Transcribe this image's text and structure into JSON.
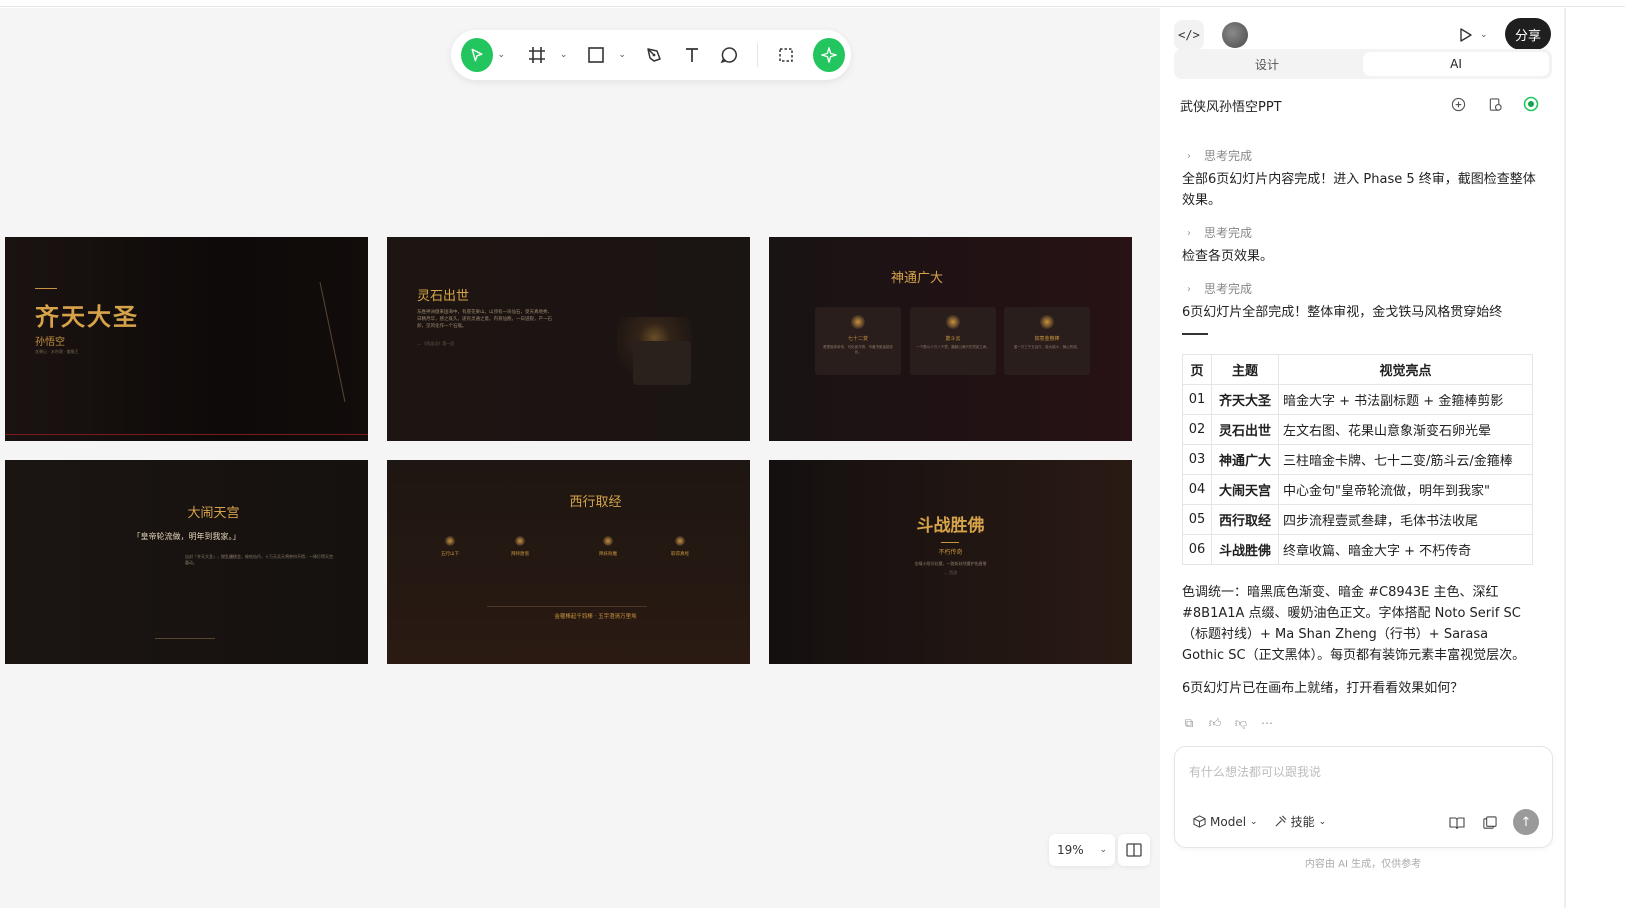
{
  "toolbar": {
    "tools": [
      "select-tool",
      "frame-tool",
      "shape-tool",
      "pen-tool",
      "text-tool",
      "comment-tool",
      "crop-tool",
      "ai-tool"
    ]
  },
  "canvas": {
    "zoom": "19%",
    "slides": [
      {
        "title": "齐天大圣",
        "subtitle": "孙悟空",
        "meta": "花果山 · 水帘洞 · 美猴王"
      },
      {
        "title": "灵石出世",
        "body": "东胜神洲傲来国海中，有座花果山。山顶有一块仙石，受天真地秀、日精月华，感之既久，遂有灵通之意。内育仙胞，一日迸裂，产一石卵，见风化作一个石猴。",
        "foot": "— 《西游记》第一回"
      },
      {
        "title": "神通广大",
        "cards": [
          {
            "name": "七十二变",
            "text": "菩提祖师亲传，可化身万物，鸟兽虫鱼皆能变化。"
          },
          {
            "name": "筋斗云",
            "text": "一个筋斗十万八千里，翻越山海只在须臾之间。"
          },
          {
            "name": "如意金箍棒",
            "text": "重一万三千五百斤，能大能小，随心所欲。"
          }
        ]
      },
      {
        "title": "大闹天宫",
        "quote": "「皇帝轮流做，明年到我家。」",
        "body": "自封「齐天大圣」，搅乱蟠桃会，偷吃仙丹，十万天兵天将奈何不得，一棒打得天宫震动。"
      },
      {
        "title": "西行取经",
        "steps": [
          "五行山下",
          "拜师唐僧",
          "降妖除魔",
          "取得真经"
        ],
        "foot": "金箍棒起千钧棒 · 玉宇澄清万里埃"
      },
      {
        "title": "斗战胜佛",
        "subtitle": "不朽传奇",
        "body": "金睛火眼识妖魔，一路斩妖除魔护佑唐僧",
        "foot": "— 西游"
      }
    ]
  },
  "panel": {
    "code_label": "</>",
    "share_label": "分享",
    "tabs": [
      {
        "label": "设计"
      },
      {
        "label": "AI"
      }
    ],
    "project_title": "武侠风孙悟空PPT",
    "messages": [
      {
        "status": "思考完成",
        "text": "全部6页幻灯片内容完成！进入 Phase 5 终审，截图检查整体效果。"
      },
      {
        "status": "思考完成",
        "text": "检查各页效果。"
      },
      {
        "status": "思考完成",
        "text": "6页幻灯片全部完成！整体审视，金戈铁马风格贯穿始终"
      }
    ],
    "table": {
      "headers": [
        "页",
        "主题",
        "视觉亮点"
      ],
      "rows": [
        {
          "page": "01",
          "topic": "齐天大圣",
          "highlight": "暗金大字 + 书法副标题 + 金箍棒剪影"
        },
        {
          "page": "02",
          "topic": "灵石出世",
          "highlight": "左文右图、花果山意象渐变石卵光晕"
        },
        {
          "page": "03",
          "topic": "神通广大",
          "highlight": "三柱暗金卡牌、七十二变/筋斗云/金箍棒"
        },
        {
          "page": "04",
          "topic": "大闹天宫",
          "highlight": "中心金句\"皇帝轮流做，明年到我家\""
        },
        {
          "page": "05",
          "topic": "西行取经",
          "highlight": "四步流程壹贰叁肆，毛体书法收尾"
        },
        {
          "page": "06",
          "topic": "斗战胜佛",
          "highlight": "终章收篇、暗金大字 + 不朽传奇"
        }
      ]
    },
    "summary": "色调统一：暗黑底色渐变、暗金 #C8943E 主色、深红 #8B1A1A 点缀、暖奶油色正文。字体搭配 Noto Serif SC（标题衬线）+ Ma Shan Zheng（行书）+ Sarasa Gothic SC（正文黑体）。每页都有装饰元素丰富视觉层次。",
    "closing": "6页幻灯片已在画布上就绪，打开看看效果如何？",
    "composer": {
      "placeholder": "有什么想法都可以跟我说",
      "model_label": "Model",
      "skills_label": "技能"
    },
    "disclaimer": "内容由 AI 生成，仅供参考"
  }
}
